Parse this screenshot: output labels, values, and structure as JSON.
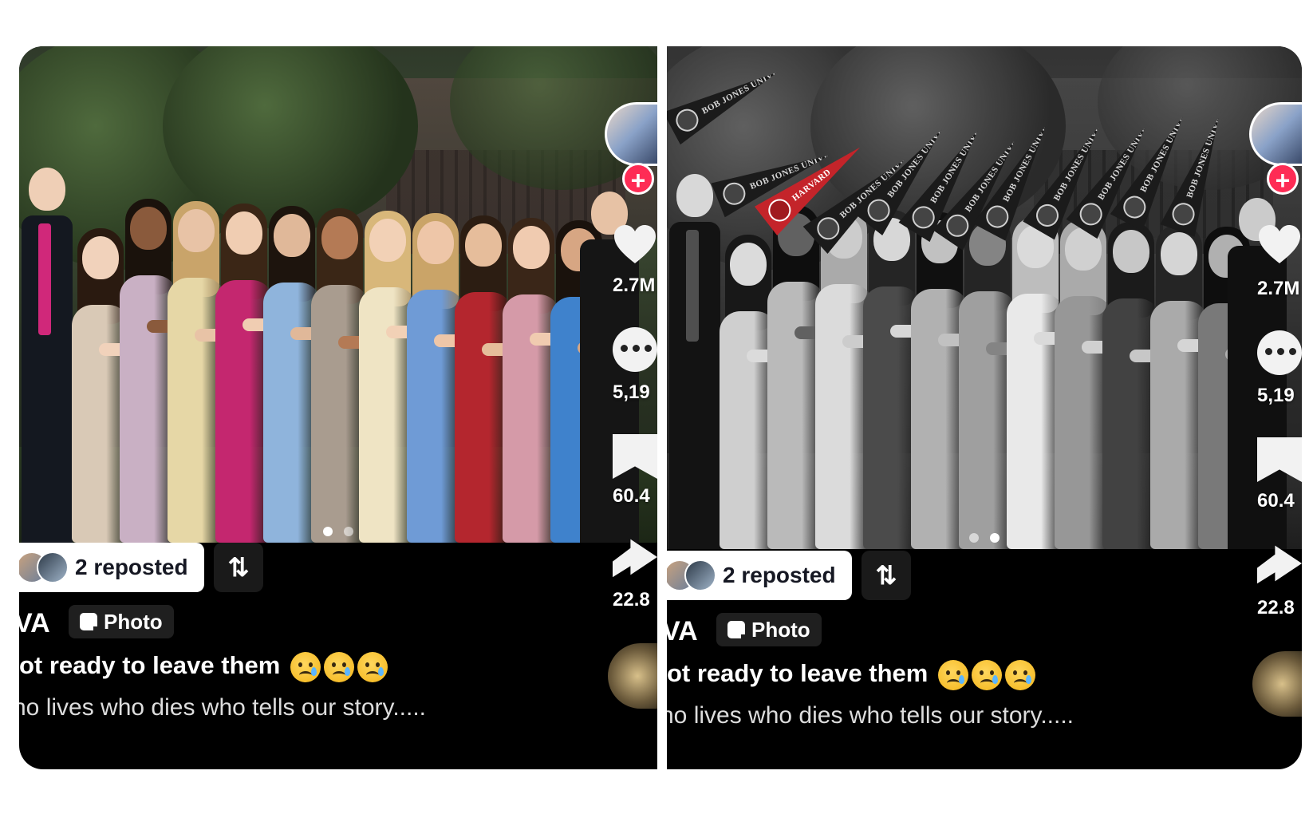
{
  "panels": [
    {
      "variant": "color",
      "likes": "2.7M",
      "comments": "5,19",
      "saves": "60.4",
      "shares": "22.8",
      "repost_label": "2 reposted",
      "repost_icon": "repost-icon",
      "username": "VA",
      "badge_label": "Photo",
      "caption_title": "ot ready to leave them",
      "caption_sub": "ho lives who dies who tells our story.....",
      "carousel_active": 0
    },
    {
      "variant": "grayscale",
      "likes": "2.7M",
      "comments": "5,19",
      "saves": "60.4",
      "shares": "22.8",
      "repost_label": "2 reposted",
      "repost_icon": "repost-icon",
      "username": "VA",
      "badge_label": "Photo",
      "caption_title": "ot ready to leave them",
      "caption_sub": "ho lives who dies who tells our story.....",
      "carousel_active": 1
    }
  ],
  "pennants": {
    "bob_jones": "BOB JONES UNIVERSITY",
    "harvard": "HARVARD"
  },
  "dress_colors": [
    "#d9c9b6",
    "#c9b0c4",
    "#e6d7a6",
    "#c4276f",
    "#8fb4dc",
    "#a99c8f",
    "#efe4c4",
    "#6f9bd6",
    "#b4262e",
    "#d59aa8",
    "#3f82cc"
  ],
  "colors": {
    "follow_plus": "#fe2c55",
    "background": "#000000"
  }
}
